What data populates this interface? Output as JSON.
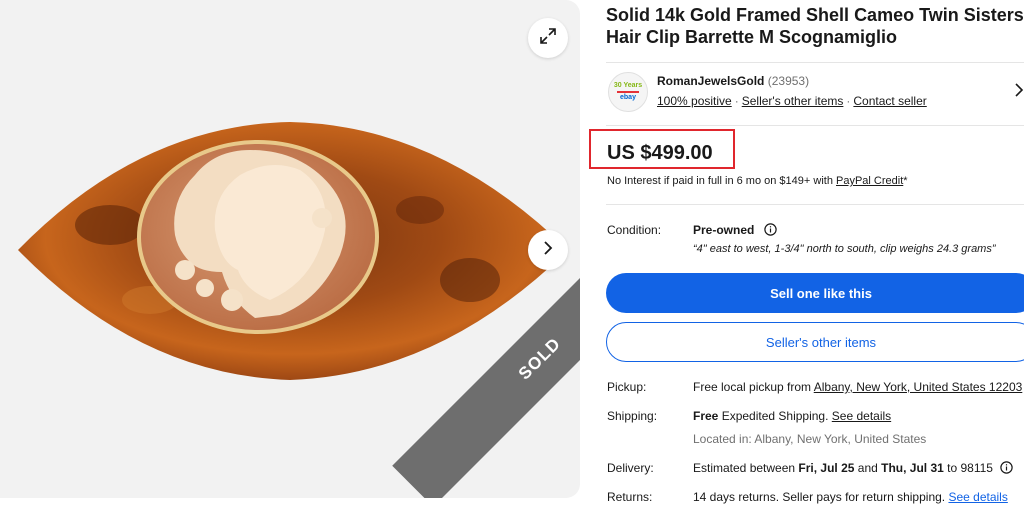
{
  "listing": {
    "title_line1": "Solid 14k Gold Framed Shell Cameo Twin Sisters",
    "title_line2": "Hair Clip Barrette M Scognamiglio",
    "sold_label": "SOLD"
  },
  "seller": {
    "avatar_line1": "30 Years",
    "avatar_line2": "ebay",
    "name": "RomanJewelsGold",
    "feedback_count": "(23953)",
    "positive": "100% positive",
    "other_items": "Seller's other items",
    "contact": "Contact seller"
  },
  "price": {
    "amount": "US $499.00",
    "credit_text": "No Interest if paid in full in 6 mo on $149+ with ",
    "credit_link": "PayPal Credit",
    "credit_suffix": "*"
  },
  "condition": {
    "label": "Condition:",
    "value": "Pre-owned",
    "description": "“4\" east to west, 1-3/4\" north to south, clip weighs 24.3 grams”"
  },
  "buttons": {
    "sell_one": "Sell one like this",
    "seller_other_items": "Seller's other items"
  },
  "pickup": {
    "label": "Pickup:",
    "text": "Free local pickup from ",
    "location_link": "Albany, New York, United States 12203"
  },
  "shipping": {
    "label": "Shipping:",
    "free": "Free",
    "method": " Expedited Shipping. ",
    "details_link": "See details",
    "located": "Located in: Albany, New York, United States"
  },
  "delivery": {
    "label": "Delivery:",
    "text": "Estimated between ",
    "date1": "Fri, Jul 25",
    "and": " and ",
    "date2": "Thu, Jul 31",
    "to": " to 98115"
  },
  "returns": {
    "label": "Returns:",
    "text": "14 days returns. Seller pays for return shipping. ",
    "details_link": "See details"
  },
  "icons": {
    "expand": "expand-icon",
    "next": "chevron-right-icon",
    "seller_chevron": "chevron-right-icon",
    "info": "info-icon"
  },
  "colors": {
    "primary_blue": "#1263e5",
    "highlight_red": "#e0262d",
    "sold_ribbon": "#6e6e6e",
    "gallery_bg": "#f2f2f2"
  }
}
